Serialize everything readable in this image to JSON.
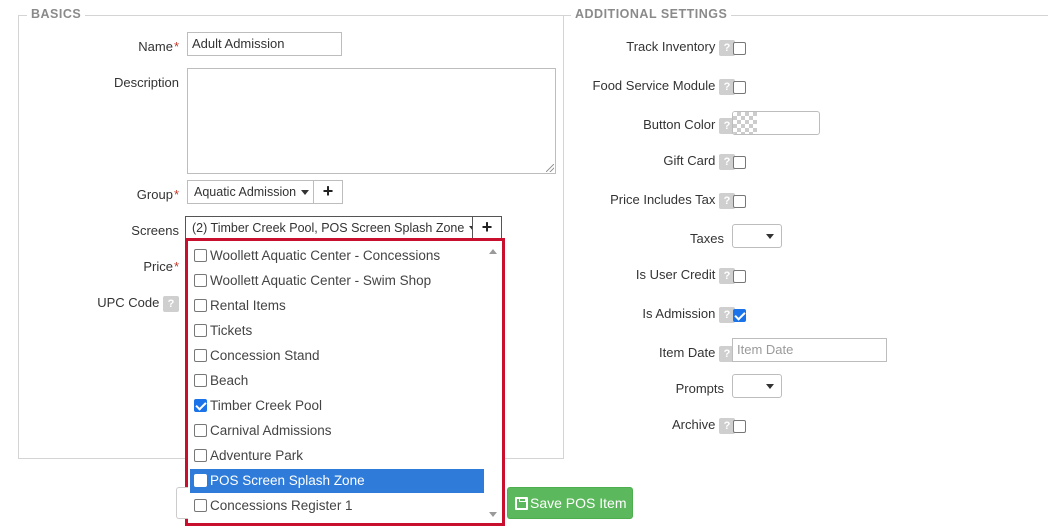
{
  "basics": {
    "legend": "BASICS",
    "name_label": "Name",
    "name_value": "Adult Admission",
    "description_label": "Description",
    "group_label": "Group",
    "group_value": "Aquatic Admission",
    "screens_label": "Screens",
    "screens_value": "(2) Timber Creek Pool, POS Screen Splash Zone",
    "price_label": "Price",
    "upc_label": "UPC Code",
    "required_mark": "*",
    "help_glyph": "?",
    "plus_glyph": "+"
  },
  "screens_dropdown": {
    "items": [
      {
        "label": "Woollett Aquatic Center - Concessions",
        "checked": false,
        "selected": false
      },
      {
        "label": "Woollett Aquatic Center - Swim Shop",
        "checked": false,
        "selected": false
      },
      {
        "label": "Rental Items",
        "checked": false,
        "selected": false
      },
      {
        "label": "Tickets",
        "checked": false,
        "selected": false
      },
      {
        "label": "Concession Stand",
        "checked": false,
        "selected": false
      },
      {
        "label": "Beach",
        "checked": false,
        "selected": false
      },
      {
        "label": "Timber Creek Pool",
        "checked": true,
        "selected": false
      },
      {
        "label": "Carnival Admissions",
        "checked": false,
        "selected": false
      },
      {
        "label": "Adventure Park",
        "checked": false,
        "selected": false
      },
      {
        "label": "POS Screen Splash Zone",
        "checked": true,
        "selected": true
      },
      {
        "label": "Concessions Register 1",
        "checked": false,
        "selected": false
      }
    ],
    "highlight_color": "#c8102e"
  },
  "additional": {
    "legend": "ADDITIONAL SETTINGS",
    "track_inventory_label": "Track Inventory",
    "track_inventory_checked": false,
    "food_service_label": "Food Service Module",
    "food_service_checked": false,
    "button_color_label": "Button Color",
    "gift_card_label": "Gift Card",
    "gift_card_checked": false,
    "price_includes_tax_label": "Price Includes Tax",
    "price_includes_tax_checked": false,
    "taxes_label": "Taxes",
    "is_user_credit_label": "Is User Credit",
    "is_user_credit_checked": false,
    "is_admission_label": "Is Admission",
    "is_admission_checked": true,
    "item_date_label": "Item Date",
    "item_date_placeholder": "Item Date",
    "prompts_label": "Prompts",
    "archive_label": "Archive",
    "archive_checked": false
  },
  "footer": {
    "save_label": "Save POS Item",
    "save_color": "#5cb85c"
  }
}
